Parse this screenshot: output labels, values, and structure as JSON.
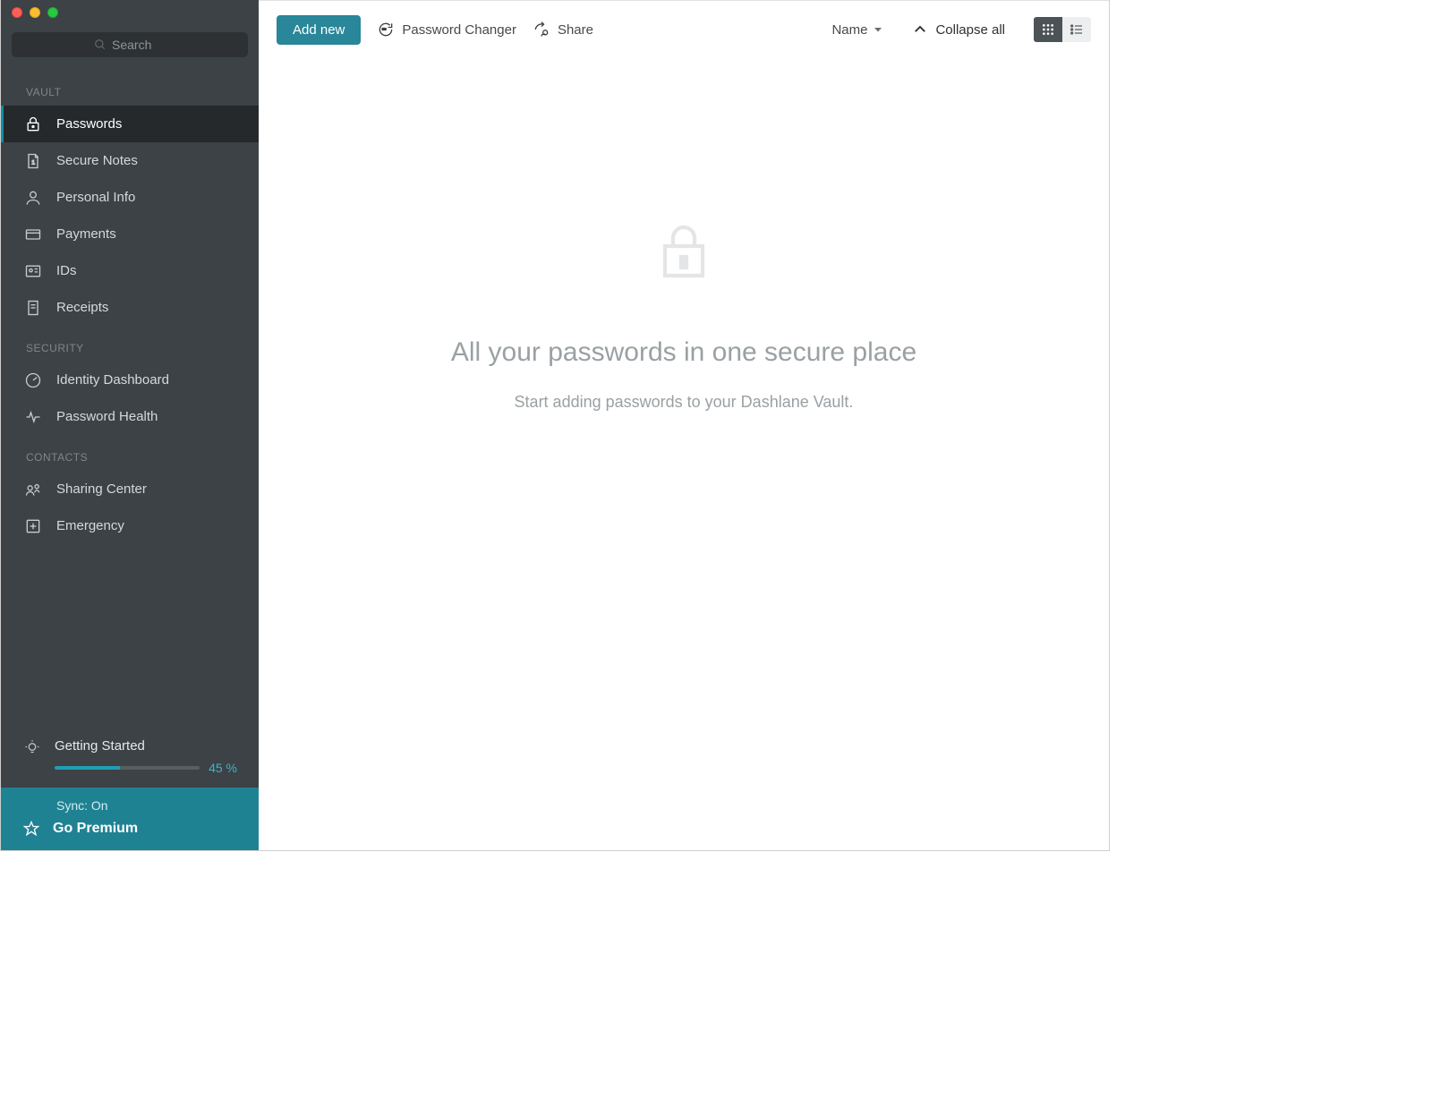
{
  "search": {
    "placeholder": "Search"
  },
  "sidebar": {
    "sections": {
      "vault": {
        "label": "VAULT",
        "items": [
          {
            "label": "Passwords"
          },
          {
            "label": "Secure Notes"
          },
          {
            "label": "Personal Info"
          },
          {
            "label": "Payments"
          },
          {
            "label": "IDs"
          },
          {
            "label": "Receipts"
          }
        ]
      },
      "security": {
        "label": "SECURITY",
        "items": [
          {
            "label": "Identity Dashboard"
          },
          {
            "label": "Password Health"
          }
        ]
      },
      "contacts": {
        "label": "CONTACTS",
        "items": [
          {
            "label": "Sharing Center"
          },
          {
            "label": "Emergency"
          }
        ]
      }
    },
    "getting_started": {
      "title": "Getting Started",
      "percent_label": "45 %",
      "percent_value": 45
    },
    "sync_label": "Sync: On",
    "premium_label": "Go Premium"
  },
  "toolbar": {
    "add_new": "Add new",
    "password_changer": "Password Changer",
    "share": "Share",
    "sort_label": "Name",
    "collapse_label": "Collapse all"
  },
  "empty": {
    "title": "All your passwords in one secure place",
    "subtitle": "Start adding passwords to your Dashlane Vault."
  },
  "colors": {
    "accent": "#2a8699",
    "sidebar_bg": "#3c4245"
  }
}
